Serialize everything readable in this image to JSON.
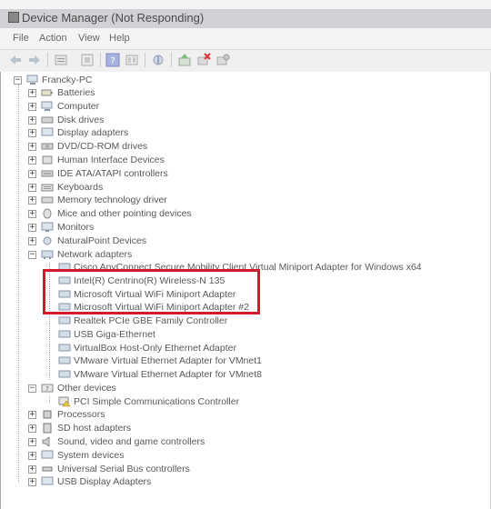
{
  "window": {
    "title": "Device Manager (Not Responding)"
  },
  "menu": [
    "File",
    "Action",
    "View",
    "Help"
  ],
  "toolbar": [
    "back-icon",
    "forward-icon",
    "properties-icon",
    "show-hidden-icon",
    "help-icon",
    "action-icon",
    "scan-hardware-icon",
    "update-driver-icon",
    "uninstall-icon",
    "disable-icon"
  ],
  "colors": {
    "highlight": "#d6182d",
    "text": "#595959"
  },
  "tree": {
    "root": "Francky-PC",
    "categories": [
      {
        "label": "Batteries"
      },
      {
        "label": "Computer"
      },
      {
        "label": "Disk drives"
      },
      {
        "label": "Display adapters"
      },
      {
        "label": "DVD/CD-ROM drives"
      },
      {
        "label": "Human Interface Devices"
      },
      {
        "label": "IDE ATA/ATAPI controllers"
      },
      {
        "label": "Keyboards"
      },
      {
        "label": "Memory technology driver"
      },
      {
        "label": "Mice and other pointing devices"
      },
      {
        "label": "Monitors"
      },
      {
        "label": "NaturalPoint Devices"
      },
      {
        "label": "Network adapters",
        "children": [
          "Cisco AnyConnect Secure Mobility Client Virtual Miniport Adapter for Windows x64",
          "Intel(R) Centrino(R) Wireless-N 135",
          "Microsoft Virtual WiFi Miniport Adapter",
          "Microsoft Virtual WiFi Miniport Adapter #2",
          "Realtek PCIe GBE Family Controller",
          "USB  Giga-Ethernet",
          "VirtualBox Host-Only Ethernet Adapter",
          "VMware Virtual Ethernet Adapter for VMnet1",
          "VMware Virtual Ethernet Adapter for VMnet8"
        ]
      },
      {
        "label": "Other devices",
        "children": [
          "PCI Simple Communications Controller"
        ]
      },
      {
        "label": "Processors"
      },
      {
        "label": "SD host adapters"
      },
      {
        "label": "Sound, video and game controllers"
      },
      {
        "label": "System devices"
      },
      {
        "label": "Universal Serial Bus controllers"
      },
      {
        "label": "USB Display Adapters"
      }
    ]
  }
}
